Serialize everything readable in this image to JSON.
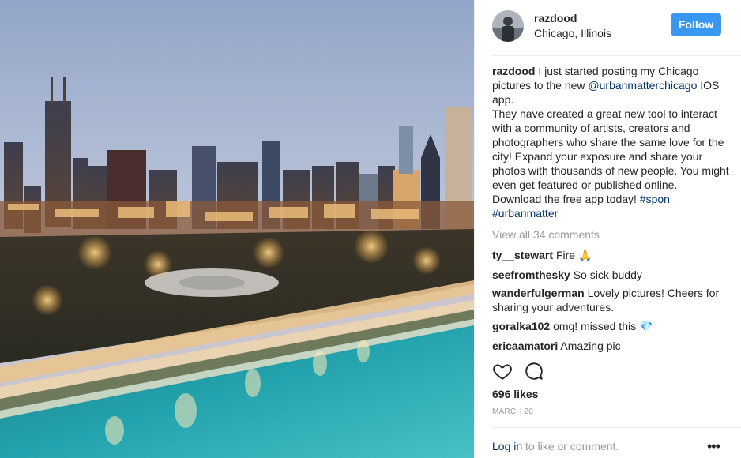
{
  "header": {
    "username": "razdood",
    "location": "Chicago, Illinois",
    "follow_label": "Follow"
  },
  "caption": {
    "username": "razdood",
    "line1_text": "I just started posting my Chicago pictures to the new",
    "mention": "@urbanmatterchicago",
    "line1_tail": "IOS app.",
    "body": "They have created a great new tool to interact with a community of artists, creators and photographers who share the same love for the city! Expand your exposure and share your photos with thousands of new people. You might even get featured or published online. Download the free app today!",
    "hashtag1": "#spon",
    "hashtag2": "#urbanmatter"
  },
  "view_all_comments": "View all 34 comments",
  "comments": [
    {
      "user": "ty__stewart",
      "text": "Fire",
      "emoji": "🙏"
    },
    {
      "user": "seefromthesky",
      "text": "So sick buddy"
    },
    {
      "user": "wanderfulgerman",
      "text": "Lovely pictures! Cheers for sharing your adventures."
    },
    {
      "user": "goralka102",
      "text": "omg! missed this",
      "emoji": "💎"
    },
    {
      "user": "ericaamatori",
      "text": "Amazing pic"
    }
  ],
  "actions": {
    "like_icon": "heart-icon",
    "comment_icon": "comment-icon"
  },
  "likes": "696 likes",
  "date": "MARCH 20",
  "footer": {
    "login_link": "Log in",
    "login_text": "to like or comment.",
    "more_label": "•••"
  },
  "colors": {
    "accent": "#3897f0",
    "link": "#003569",
    "muted": "#999999",
    "text": "#262626"
  }
}
